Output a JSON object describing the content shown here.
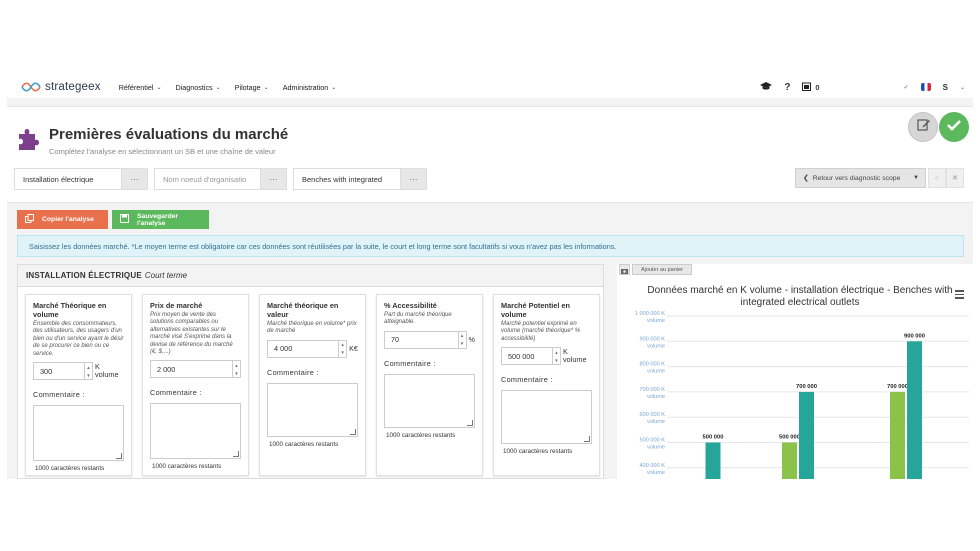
{
  "nav": {
    "brand": "strategeex",
    "menu": [
      "Référentiel",
      "Diagnostics",
      "Pilotage",
      "Administration"
    ],
    "help": "?",
    "notif_count": "0",
    "lang": "S"
  },
  "header": {
    "title": "Premières évaluations du marché",
    "subtitle": "Complétez l'analyse en sélectionnant un SB et une chaîne de valeur",
    "select1": "Installation électrique",
    "select2_placeholder": "Nom noeud d'organisatio",
    "select3": "Benches with integrated",
    "dots": "···",
    "retour": "Retour vers diagnostic scope"
  },
  "actions": {
    "copy": "Copier l'analyse",
    "save": "Sauvegarder l'analyse"
  },
  "info": "Saisissez les données marché. *Le moyen terme est obligatoire car ces données sont réutilisées par la suite, le court et long terme sont facultatifs si vous n'avez pas les informations.",
  "panel": {
    "title": "INSTALLATION ÉLECTRIQUE",
    "term": "Court terme",
    "comment_label": "Commentaire :",
    "remaining": "1000 caractères restants",
    "cards": [
      {
        "title": "Marché Théorique en volume",
        "desc": "Ensemble des consommateurs, des utilisateurs, des usagers d'un bien ou d'un service ayant le désir de se procurer ce bien ou ce service.",
        "value": "300",
        "unit": "K volume"
      },
      {
        "title": "Prix de marché",
        "desc": "Prix moyen de vente des solutions comparables ou alternatives existantes sur le marché visé S'exprime dans la devise de référence du marché (€, $,...)",
        "value": "2 000",
        "unit": ""
      },
      {
        "title": "Marché théorique en valeur",
        "desc": "Marché théorique en volume* prix de marché",
        "value": "4 000",
        "unit": "K€"
      },
      {
        "title": "% Accessibilité",
        "desc": "Part du marché théorique atteignable.",
        "value": "70",
        "unit": "%"
      },
      {
        "title": "Marché Potentiel en volume",
        "desc": "Marché potentiel exprimé en volume (marché théorique* % accessibilité)",
        "value": "500 000",
        "unit": "K volume"
      }
    ]
  },
  "chart_toolbar": {
    "panier": "Ajouter au panier"
  },
  "chart_data": {
    "type": "bar",
    "title": "Données marché en K volume - installation électrique - Benches with integrated electrical outlets",
    "ylabel": "",
    "y_tick_labels": [
      "1 000 000 K volume",
      "900 000 K volume",
      "800 000 K volume",
      "700 000 K volume",
      "600 000 K volume",
      "500 000 K volume",
      "400 000 K volume"
    ],
    "ylim": [
      400000,
      1000000
    ],
    "grid": true,
    "colors": {
      "green": "#8bc34a",
      "teal": "#26a69a"
    },
    "groups": [
      {
        "bars": [
          {
            "color": "teal",
            "value": 500000,
            "label": "500 000"
          }
        ]
      },
      {
        "bars": [
          {
            "color": "green",
            "value": 500000,
            "label": "500 000"
          },
          {
            "color": "teal",
            "value": 700000,
            "label": "700 000"
          }
        ]
      },
      {
        "bars": [
          {
            "color": "green",
            "value": 700000,
            "label": "700 000"
          },
          {
            "color": "teal",
            "value": 900000,
            "label": "900 000"
          }
        ]
      }
    ]
  }
}
